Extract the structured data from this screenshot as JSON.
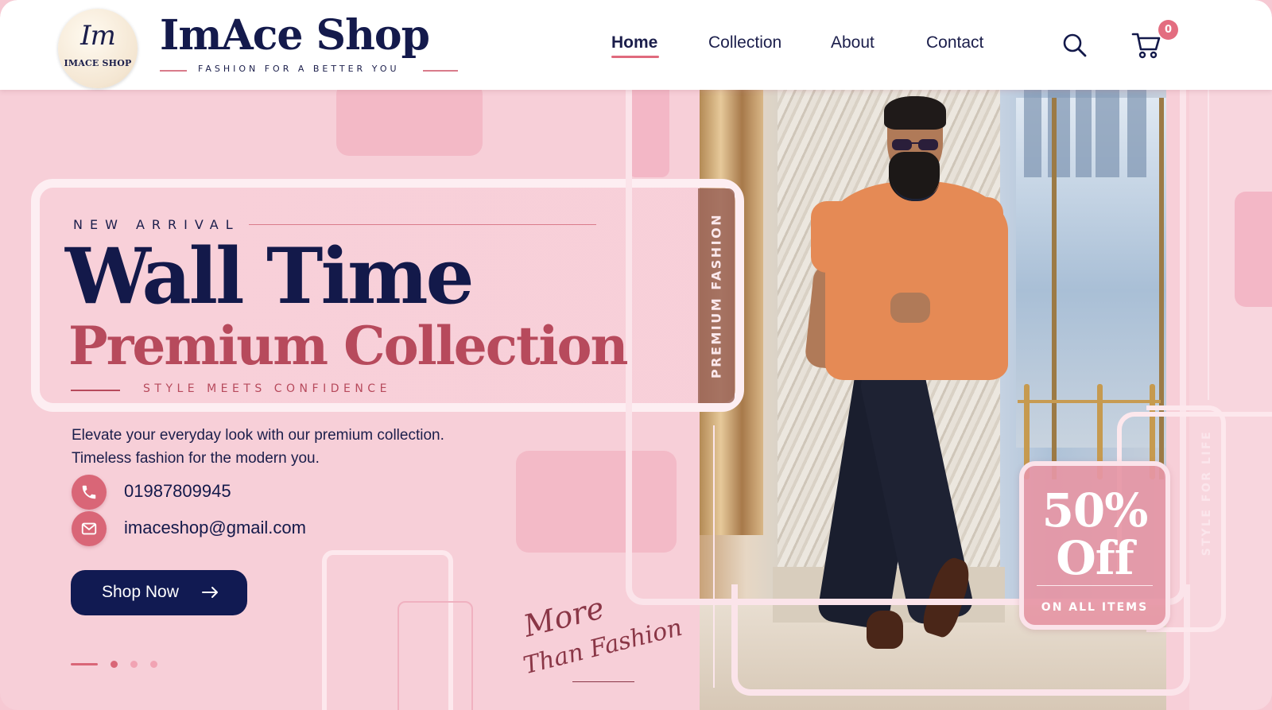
{
  "brand": {
    "logo_monogram": "Im",
    "logo_text": "IMACE SHOP",
    "name": "ImAce Shop",
    "tagline": "FASHION FOR A BETTER YOU"
  },
  "nav": {
    "items": [
      {
        "label": "Home",
        "active": true
      },
      {
        "label": "Collection",
        "active": false
      },
      {
        "label": "About",
        "active": false
      },
      {
        "label": "Contact",
        "active": false
      }
    ]
  },
  "header_icons": {
    "search": "search-icon",
    "cart": "cart-icon",
    "cart_count": "0"
  },
  "hero": {
    "eyebrow": "NEW ARRIVAL",
    "title": "Wall Time",
    "title_accent": "Premium Collection",
    "subtitle": "STYLE MEETS CONFIDENCE",
    "description_line1": "Elevate your everyday look with our premium collection.",
    "description_line2": "Timeless fashion for the modern you.",
    "phone": "01987809945",
    "email": "imaceshop@gmail.com",
    "cta_label": "Shop Now",
    "script_line1": "More",
    "script_line2": "Than Fashion",
    "slider": {
      "current_slide": 1,
      "total_slides": 3
    }
  },
  "photo_labels": {
    "side_tag": "PREMIUM FASHION",
    "vertical_tag": "STYLE FOR LIFE"
  },
  "offer": {
    "percent": "50%",
    "off": "Off",
    "sub": "ON ALL ITEMS"
  },
  "colors": {
    "navy": "#13194a",
    "rose_accent": "#b74a5c",
    "pink_accent": "#d96677",
    "background_pink": "#f7cfd8",
    "offer_pink": "#e696a5"
  }
}
